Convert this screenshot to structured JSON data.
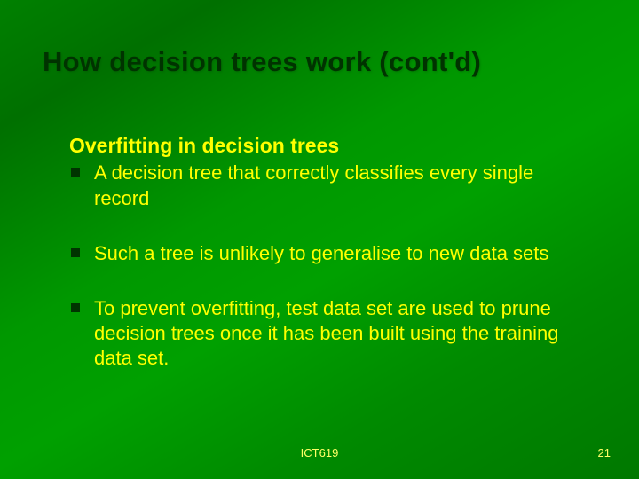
{
  "slide": {
    "title": "How decision trees work (cont'd)",
    "subheading": "Overfitting in decision trees",
    "bullets": [
      "A decision tree that correctly classifies every single record",
      "Such a tree is unlikely to generalise to new data sets",
      "To prevent overfitting, test data set are used to prune decision trees once it has been built using the training data set."
    ],
    "footer_course": "ICT619",
    "footer_page": "21"
  }
}
